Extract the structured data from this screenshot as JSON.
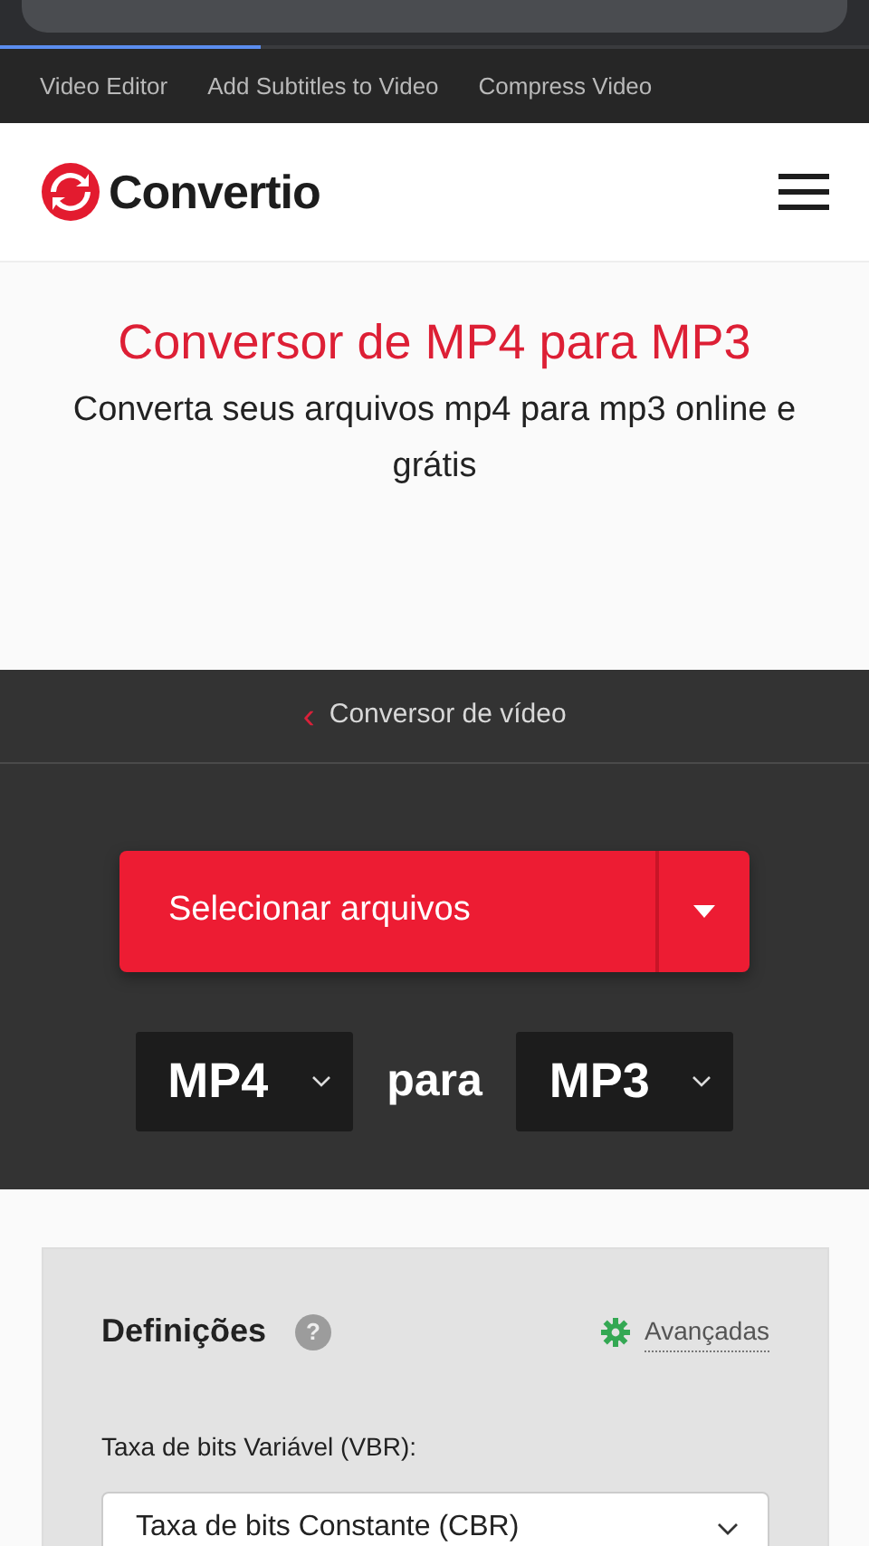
{
  "browser": {
    "load_progress": {
      "level": 0.3
    }
  },
  "top_links": [
    "Video Editor",
    "Add Subtitles to Video",
    "Compress Video"
  ],
  "header": {
    "logo_text": "Convertio"
  },
  "hero": {
    "title": "Conversor de MP4 para MP3",
    "subtitle": "Converta seus arquivos mp4 para mp3 online e grátis"
  },
  "breadcrumb": {
    "back_symbol": "‹",
    "label": "Conversor de vídeo"
  },
  "converter": {
    "select_button": "Selecionar arquivos",
    "from_format": "MP4",
    "connector": "para",
    "to_format": "MP3"
  },
  "settings": {
    "title": "Definições",
    "help": "?",
    "advanced_link": "Avançadas",
    "field_label": "Taxa de bits Variável (VBR):",
    "field_value": "Taxa de bits Constante (CBR)"
  }
}
